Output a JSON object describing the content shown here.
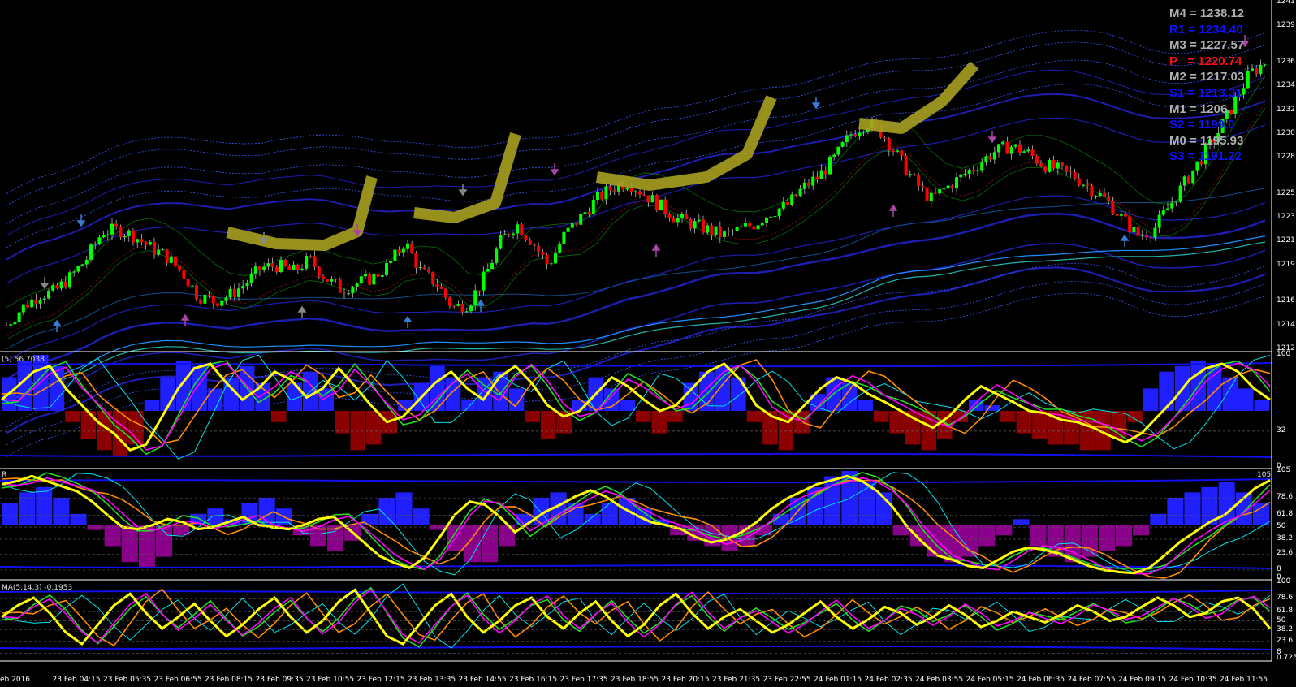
{
  "chart_data": [
    {
      "type": "line",
      "panel": "price",
      "ylim": [
        1212,
        1241
      ],
      "y_ticks": [
        "1241",
        "1239",
        "1236",
        "1234",
        "1232",
        "1230",
        "1228",
        "1225",
        "1223",
        "1221",
        "1219",
        "1216",
        "1214",
        "1212"
      ],
      "x_ticks": [
        "eb 2016",
        "23 Feb 04:15",
        "23 Feb 05:35",
        "23 Feb 06:55",
        "23 Feb 08:15",
        "23 Feb 09:35",
        "23 Feb 10:55",
        "23 Feb 12:15",
        "23 Feb 13:35",
        "23 Feb 14:55",
        "23 Feb 16:15",
        "23 Feb 17:35",
        "23 Feb 18:55",
        "23 Feb 20:15",
        "23 Feb 21:35",
        "23 Feb 22:55",
        "24 Feb 01:15",
        "24 Feb 02:35",
        "24 Feb 03:55",
        "24 Feb 05:15",
        "24 Feb 06:35",
        "24 Feb 07:55",
        "24 Feb 09:15",
        "24 Feb 10:35",
        "24 Feb 11:55"
      ],
      "close_path": [
        1214.0,
        1215.5,
        1216.5,
        1216.8,
        1218.0,
        1219.5,
        1221.8,
        1222.0,
        1221.5,
        1220.5,
        1219.8,
        1218.5,
        1216.5,
        1216.0,
        1216.5,
        1217.5,
        1218.8,
        1219.0,
        1218.5,
        1219.5,
        1218.0,
        1217.0,
        1217.5,
        1218.0,
        1219.0,
        1221.0,
        1218.5,
        1217.5,
        1215.5,
        1215.8,
        1218.0,
        1221.0,
        1222.5,
        1221.0,
        1219.0,
        1221.5,
        1223.0,
        1224.5,
        1225.5,
        1226.0,
        1225.0,
        1224.0,
        1223.0,
        1222.5,
        1222.0,
        1221.5,
        1222.0,
        1222.5,
        1223.5,
        1224.0,
        1225.5,
        1226.5,
        1228.0,
        1230.0,
        1231.0,
        1230.0,
        1228.0,
        1226.0,
        1224.5,
        1225.5,
        1226.5,
        1227.5,
        1228.5,
        1229.0,
        1228.5,
        1227.5,
        1227.0,
        1226.5,
        1225.5,
        1224.5,
        1223.0,
        1221.5,
        1222.0,
        1224.0,
        1226.0,
        1228.0,
        1230.0,
        1232.5,
        1235.0,
        1236.0
      ],
      "pivots": [
        {
          "name": "M4",
          "text": "M4 = 1238.12",
          "color": "#b0b0b0",
          "value": 1238.12
        },
        {
          "name": "R1",
          "text": "R1 = 1234.40",
          "color": "#1010ff",
          "value": 1234.4
        },
        {
          "name": "M3",
          "text": "M3 = 1227.57",
          "color": "#b0b0b0",
          "value": 1227.57
        },
        {
          "name": "P",
          "text": "P   = 1220.74",
          "color": "#ff1010",
          "value": 1220.74
        },
        {
          "name": "M2",
          "text": "M2 = 1217.03",
          "color": "#b0b0b0",
          "value": 1217.03
        },
        {
          "name": "S1",
          "text": "S1 = 1213.31",
          "color": "#1010ff",
          "value": 1213.31
        },
        {
          "name": "M1",
          "text": "M1 = 1206.",
          "color": "#b0b0b0",
          "value": 1206.0
        },
        {
          "name": "S2",
          "text": "S2 = 1199.0",
          "color": "#1010ff",
          "value": 1199.0
        },
        {
          "name": "M0",
          "text": "M0 = 1195.93",
          "color": "#b0b0b0",
          "value": 1195.93
        },
        {
          "name": "S3",
          "text": "S3 = 1191.22",
          "color": "#1010ff",
          "value": 1191.22
        }
      ],
      "colors": {
        "up": "#00ff00",
        "down": "#ff0000",
        "band": "#2222cc",
        "ma": "#1e90ff",
        "highlight": "#a8a020"
      }
    },
    {
      "type": "line",
      "panel": "oscillator-1",
      "label": "(5) 56.7038",
      "ylim": [
        0,
        100
      ],
      "y_ticks": [
        "100",
        "32",
        "0"
      ],
      "series": [
        {
          "values": [
            60,
            72,
            85,
            90,
            70,
            55,
            40,
            30,
            15,
            20,
            45,
            70,
            88,
            92,
            75,
            60,
            70,
            85,
            78,
            62,
            70,
            88,
            72,
            55,
            40,
            45,
            60,
            75,
            85,
            70,
            60,
            80,
            90,
            75,
            55,
            45,
            50,
            65,
            80,
            72,
            60,
            50,
            55,
            70,
            85,
            92,
            78,
            55,
            45,
            40,
            55,
            70,
            80,
            75,
            65,
            58,
            50,
            42,
            35,
            45,
            60,
            72,
            65,
            58,
            50,
            48,
            42,
            40,
            35,
            28,
            22,
            30,
            45,
            60,
            78,
            88,
            92,
            85,
            70,
            60
          ]
        }
      ],
      "histogram": [
        30,
        45,
        50,
        40,
        -10,
        -25,
        -35,
        -40,
        -30,
        10,
        30,
        45,
        40,
        20,
        30,
        40,
        25,
        -10,
        25,
        35,
        20,
        -20,
        -35,
        -30,
        -20,
        10,
        25,
        40,
        30,
        10,
        30,
        35,
        20,
        -10,
        -25,
        -20,
        10,
        30,
        20,
        10,
        -10,
        -20,
        -10,
        25,
        35,
        40,
        30,
        -10,
        -30,
        -35,
        -20,
        15,
        30,
        25,
        10,
        -10,
        -20,
        -30,
        -35,
        -25,
        -10,
        10,
        5,
        -10,
        -20,
        -25,
        -30,
        -30,
        -35,
        -35,
        -25,
        -10,
        20,
        35,
        40,
        45,
        40,
        30,
        20,
        10
      ]
    },
    {
      "type": "line",
      "panel": "oscillator-2",
      "label": "R",
      "right_label": "105",
      "ylim": [
        0,
        105
      ],
      "y_ticks": [
        "105",
        "78.6",
        "61.8",
        "50",
        "38.2",
        "23.6",
        "8",
        "0"
      ],
      "series": [
        {
          "values": [
            92,
            95,
            100,
            95,
            90,
            85,
            75,
            62,
            50,
            48,
            52,
            58,
            55,
            48,
            50,
            55,
            60,
            52,
            50,
            48,
            52,
            58,
            60,
            48,
            35,
            22,
            15,
            10,
            20,
            40,
            62,
            75,
            72,
            60,
            45,
            55,
            65,
            72,
            80,
            86,
            80,
            70,
            62,
            55,
            52,
            48,
            40,
            35,
            38,
            45,
            55,
            68,
            78,
            85,
            92,
            96,
            100,
            95,
            85,
            70,
            50,
            35,
            22,
            18,
            12,
            10,
            18,
            26,
            30,
            28,
            24,
            18,
            12,
            8,
            6,
            5,
            10,
            22,
            35,
            45,
            55,
            62,
            75,
            88,
            96
          ]
        }
      ],
      "histogram": [
        20,
        30,
        35,
        25,
        10,
        -5,
        -20,
        -35,
        -40,
        -30,
        -10,
        10,
        15,
        5,
        20,
        25,
        15,
        -10,
        -20,
        -25,
        -15,
        10,
        25,
        30,
        15,
        -5,
        -25,
        -35,
        -35,
        -20,
        10,
        25,
        30,
        20,
        10,
        20,
        25,
        15,
        5,
        -10,
        -15,
        -20,
        -25,
        -20,
        -10,
        10,
        25,
        35,
        45,
        50,
        40,
        30,
        -10,
        -20,
        -30,
        -35,
        -30,
        -20,
        -10,
        5,
        -20,
        -30,
        -35,
        -30,
        -25,
        -20,
        -10,
        10,
        25,
        30,
        35,
        40,
        30,
        20
      ]
    },
    {
      "type": "line",
      "panel": "oscillator-3",
      "label": "MA(5,14,3) -0.1953",
      "ylim": [
        0,
        100
      ],
      "y_ticks": [
        "100",
        "78.6",
        "61.8",
        "50",
        "38.2",
        "23.6",
        "8",
        "0.725"
      ],
      "series": [
        {
          "values": [
            55,
            70,
            80,
            60,
            35,
            20,
            45,
            70,
            85,
            60,
            40,
            55,
            72,
            50,
            30,
            45,
            65,
            80,
            55,
            35,
            50,
            75,
            90,
            60,
            30,
            20,
            45,
            70,
            85,
            55,
            35,
            50,
            70,
            80,
            55,
            40,
            60,
            75,
            50,
            30,
            45,
            70,
            85,
            60,
            40,
            55,
            65,
            50,
            35,
            45,
            60,
            75,
            55,
            40,
            52,
            68,
            60,
            45,
            55,
            70,
            58,
            42,
            50,
            62,
            55,
            48,
            58,
            70,
            62,
            50,
            55,
            68,
            80,
            70,
            55,
            60,
            75,
            80,
            65,
            40
          ]
        }
      ]
    }
  ]
}
